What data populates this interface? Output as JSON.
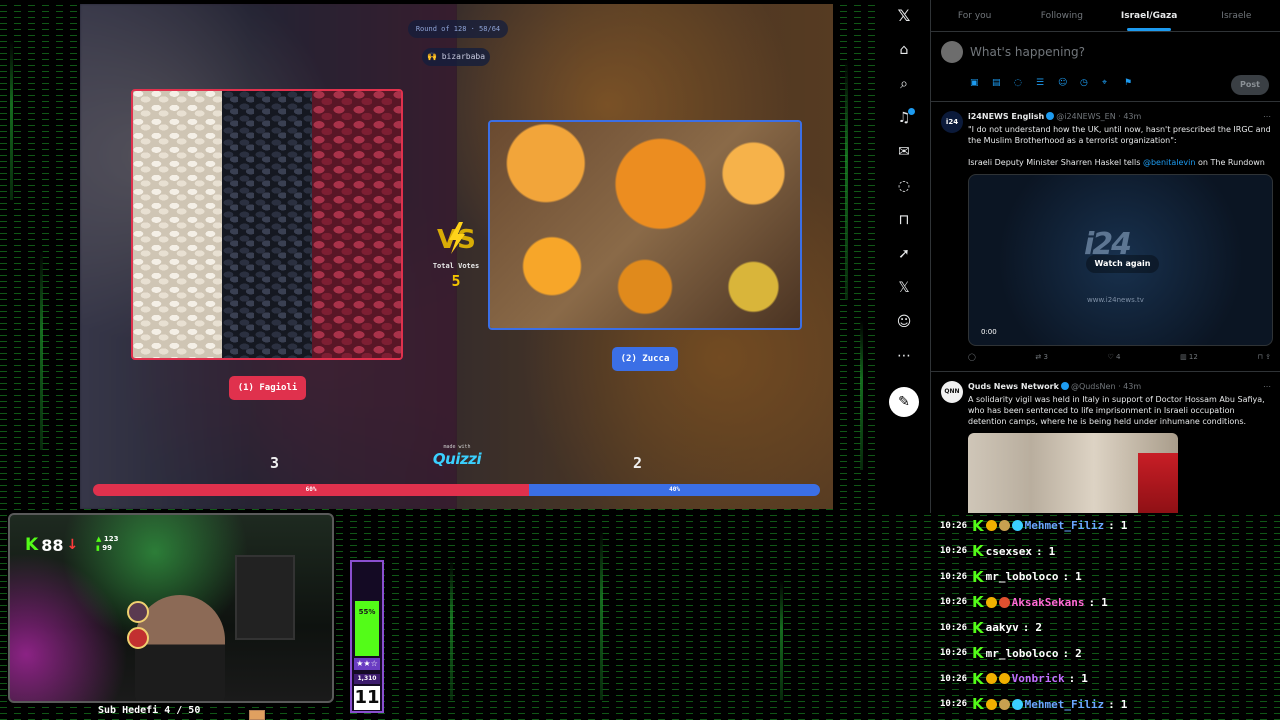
{
  "quiz": {
    "round_label": "Round of 128 · 58/64",
    "creator": "🙌 bizarbaba",
    "left": {
      "label": "(1) Fagioli",
      "votes": "3"
    },
    "right": {
      "label": "(2) Zucca",
      "votes": "2"
    },
    "total_votes_label": "Total Votes",
    "total_votes": "5",
    "made_with": "made with",
    "brand": "Quizzi",
    "progress": {
      "left_pct_label": "60%",
      "right_pct_label": "40%",
      "left_fraction": 0.6
    },
    "colors": {
      "left": "#e0314d",
      "right": "#3b6fe6",
      "accent": "#f5c400"
    }
  },
  "x_nav": {
    "icons": [
      "x-logo-icon",
      "home-icon",
      "search-icon",
      "bell-icon",
      "message-icon",
      "grok-icon",
      "bookmark-icon",
      "rocket-icon",
      "x-premium-icon",
      "profile-icon",
      "more-icon",
      "compose-icon"
    ]
  },
  "feed": {
    "tabs": [
      "For you",
      "Following",
      "Israel/Gaza",
      "Israele"
    ],
    "active_tab": 2,
    "compose_placeholder": "What's happening?",
    "post_label": "Post",
    "tweets": [
      {
        "name": "i24NEWS English",
        "handle": "@i24NEWS_EN",
        "time": "· 43m",
        "avatar_text": "i24",
        "text": "\"I do not understand how the UK, until now, hasn't prescribed the IRGC and the Muslim Brotherhood as a terrorist organization\":",
        "text2_pre": "Israeli Deputy Minister Sharren Haskel tells ",
        "text2_link": "@benitalevin",
        "text2_post": " on The Rundown",
        "media_logo": "i24",
        "media_watch": "Watch again",
        "media_site": "www.i24news.tv",
        "media_time": "0:00",
        "replies": "",
        "retweets": "3",
        "likes": "4",
        "views": "12"
      },
      {
        "name": "Quds News Network",
        "handle": "@QudsNen",
        "time": "· 43m",
        "avatar_text": "QNN",
        "text": "A solidarity vigil was held in Italy in support of Doctor Hossam Abu Safiya, who has been sentenced to life imprisonment in Israeli occupation detention camps, where he is being held under inhumane conditions."
      }
    ]
  },
  "stream": {
    "follower_count": "88",
    "mini_stats_top": "123",
    "mini_stats_bottom": "99",
    "sub_goal": "Sub Hedefi 4 / 50",
    "meter_pct": "55%",
    "meter_fraction": 0.55,
    "meter_count": "1,310",
    "meter_level": "11",
    "brand_color": "#53fc18"
  },
  "chat": [
    {
      "time": "10:26",
      "user": "Mehmet_Filiz",
      "value": "1",
      "color": "#6aa8ff",
      "badges": [
        "#f0b000",
        "#c7a050",
        "#3ad0ff"
      ]
    },
    {
      "time": "10:26",
      "user": "csexsex",
      "value": "1",
      "color": "#ffffff",
      "badges": []
    },
    {
      "time": "10:26",
      "user": "mr_loboloco",
      "value": "1",
      "color": "#ffffff",
      "badges": []
    },
    {
      "time": "10:26",
      "user": "AksakSekans",
      "value": "1",
      "color": "#ff6ad5",
      "badges": [
        "#f0b000",
        "#e05030"
      ]
    },
    {
      "time": "10:26",
      "user": "aakyv",
      "value": "2",
      "color": "#ffffff",
      "badges": []
    },
    {
      "time": "10:26",
      "user": "mr_loboloco",
      "value": "2",
      "color": "#ffffff",
      "badges": []
    },
    {
      "time": "10:26",
      "user": "Vonbrick",
      "value": "1",
      "color": "#c070ff",
      "badges": [
        "#f0b000",
        "#f0b000"
      ]
    },
    {
      "time": "10:26",
      "user": "Mehmet_Filiz",
      "value": "1",
      "color": "#6aa8ff",
      "badges": [
        "#f0b000",
        "#c7a050",
        "#3ad0ff"
      ]
    }
  ]
}
